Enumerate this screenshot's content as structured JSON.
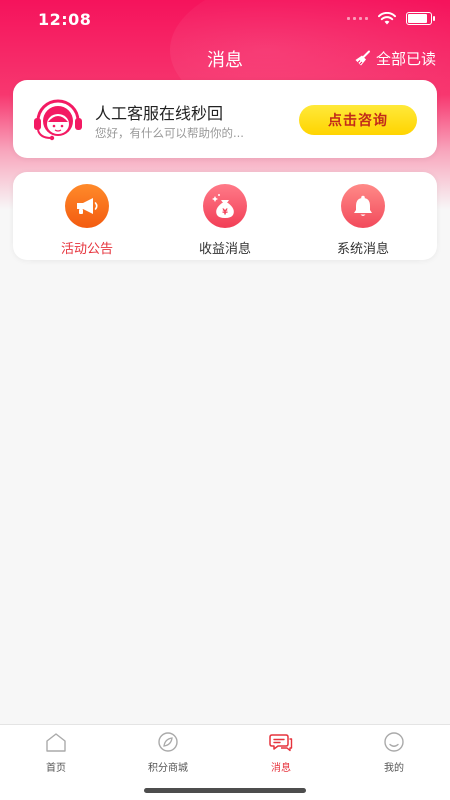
{
  "status_bar": {
    "time": "12:08"
  },
  "nav": {
    "title": "消息",
    "mark_all_read": "全部已读"
  },
  "service": {
    "title": "人工客服在线秒回",
    "subtitle": "您好，有什么可以帮助你的...",
    "consult_button": "点击咨询"
  },
  "categories": [
    {
      "label": "活动公告",
      "icon": "megaphone-icon",
      "color": "#fb6d1c",
      "active": true
    },
    {
      "label": "收益消息",
      "icon": "money-bag-icon",
      "color": "#f5495f",
      "active": false
    },
    {
      "label": "系统消息",
      "icon": "bell-icon",
      "color": "#f5495f",
      "active": false
    }
  ],
  "tab_bar": {
    "items": [
      {
        "label": "首页",
        "icon": "home-icon"
      },
      {
        "label": "积分商城",
        "icon": "compass-icon"
      },
      {
        "label": "消息",
        "icon": "chat-icon",
        "active": true
      },
      {
        "label": "我的",
        "icon": "profile-icon"
      }
    ]
  },
  "colors": {
    "brand": "#f5135c",
    "accent_red": "#e6343d",
    "button_yellow": "#ffd400"
  }
}
